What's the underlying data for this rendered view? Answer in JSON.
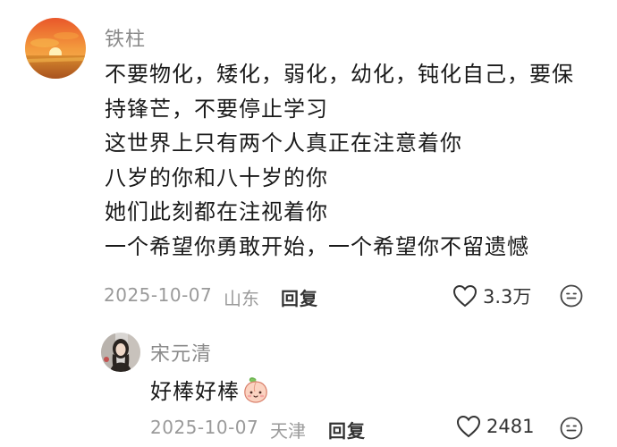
{
  "comment": {
    "author": "铁柱",
    "lines": [
      "不要物化，矮化，弱化，幼化，钝化自己，要保",
      "持锋芒，不要停止学习",
      "这世界上只有两个人真正在注意着你",
      "八岁的你和八十岁的你",
      "她们此刻都在注视着你",
      "一个希望你勇敢开始，一个希望你不留遗憾"
    ],
    "date": "2025-10-07",
    "location": "山东",
    "reply_label": "回复",
    "likes": "3.3万"
  },
  "reply": {
    "author": "宋元清",
    "text": "好棒好棒",
    "date": "2025-10-07",
    "location": "天津",
    "reply_label": "回复",
    "likes": "2481"
  },
  "icons": {
    "like": "heart-outline-icon",
    "emoji": "smiley-face-icon",
    "reply_sticker": "peach-emoji-icon"
  },
  "colors": {
    "meta": "#9a9a9a",
    "author": "#8a8a8a",
    "text": "#1a1a1a"
  }
}
